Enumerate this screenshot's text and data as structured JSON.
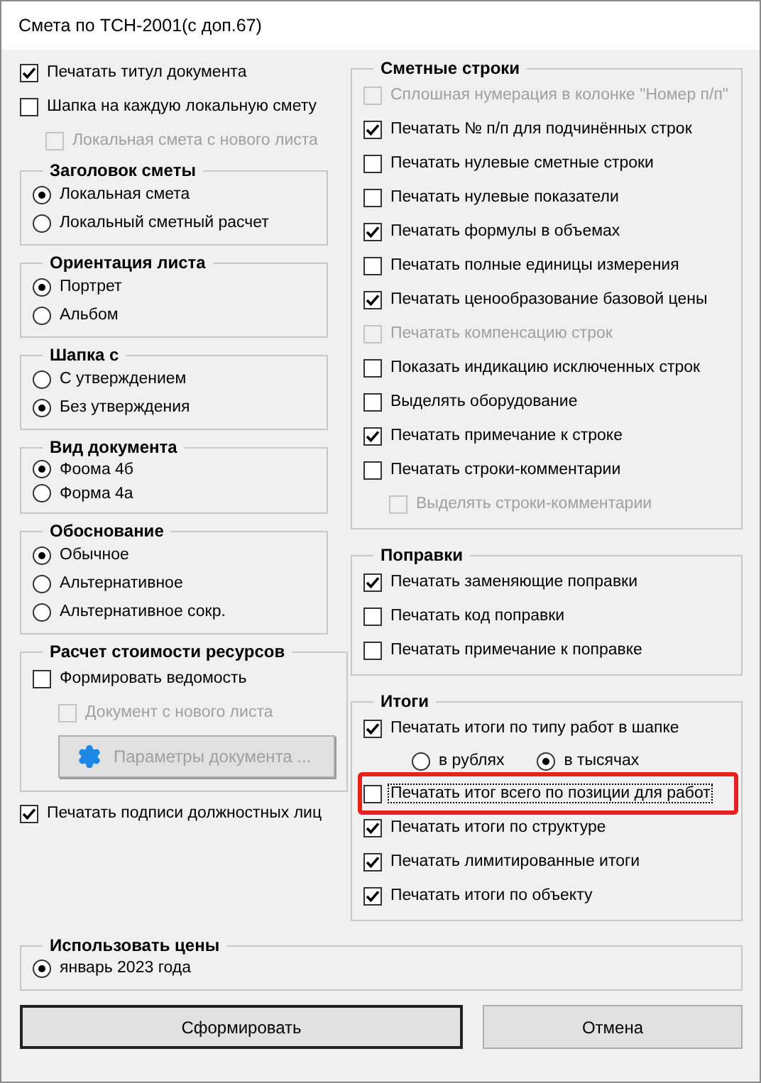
{
  "window": {
    "title": "Смета по ТСН-2001(с доп.67)"
  },
  "left": [
    {
      "kind": "checkbox",
      "label": "Печатать титул документа",
      "checked": true,
      "disabled": false
    },
    {
      "kind": "checkbox",
      "label": "Шапка на каждую локальную смету",
      "checked": false,
      "disabled": false,
      "children": [
        {
          "kind": "checkbox",
          "label": "Локальная смета с нового листа",
          "checked": false,
          "disabled": true
        }
      ]
    },
    {
      "kind": "group",
      "title": "Заголовок сметы",
      "items": [
        {
          "kind": "radio",
          "label": "Локальная смета",
          "selected": true
        },
        {
          "kind": "radio",
          "label": "Локальный сметный расчет",
          "selected": false
        }
      ]
    },
    {
      "kind": "group",
      "title": "Ориентация листа",
      "items": [
        {
          "kind": "radio",
          "label": "Портрет",
          "selected": true
        },
        {
          "kind": "radio",
          "label": "Альбом",
          "selected": false
        }
      ]
    },
    {
      "kind": "group",
      "title": "Шапка с",
      "items": [
        {
          "kind": "radio",
          "label": "С утверждением",
          "selected": false
        },
        {
          "kind": "radio",
          "label": "Без утверждения",
          "selected": true
        }
      ]
    },
    {
      "kind": "group",
      "title": "Вид документа",
      "items": [
        {
          "kind": "radio",
          "label": "Фоома 4б",
          "selected": true
        },
        {
          "kind": "radio",
          "label": "Форма 4а",
          "selected": false
        }
      ]
    },
    {
      "kind": "group",
      "title": "Обоснование",
      "items": [
        {
          "kind": "radio",
          "label": "Обычное",
          "selected": true
        },
        {
          "kind": "radio",
          "label": "Альтернативное",
          "selected": false
        },
        {
          "kind": "radio",
          "label": "Альтернативное сокр.",
          "selected": false
        }
      ]
    },
    {
      "kind": "group",
      "title": "Расчет стоимости ресурсов",
      "items": [
        {
          "kind": "checkbox",
          "label": "Формировать ведомость",
          "checked": false,
          "disabled": false,
          "children": [
            {
              "kind": "checkbox",
              "label": "Документ с нового листа",
              "checked": false,
              "disabled": true
            }
          ]
        },
        {
          "kind": "button",
          "label": "Параметры документа ...",
          "disabled": true
        }
      ]
    },
    {
      "kind": "checkbox",
      "label": "Печатать подписи должностных лиц",
      "checked": true,
      "disabled": false
    }
  ],
  "right": [
    {
      "kind": "group",
      "title": "Сметные строки",
      "items": [
        {
          "kind": "checkbox",
          "label": "Сплошная нумерация в колонке \"Номер п/п\"",
          "checked": false,
          "disabled": true
        },
        {
          "kind": "checkbox",
          "label": "Печатать № п/п для подчинённых строк",
          "checked": true,
          "disabled": false
        },
        {
          "kind": "checkbox",
          "label": "Печатать нулевые сметные строки",
          "checked": false,
          "disabled": false
        },
        {
          "kind": "checkbox",
          "label": "Печатать нулевые показатели",
          "checked": false,
          "disabled": false
        },
        {
          "kind": "checkbox",
          "label": "Печатать формулы в объемах",
          "checked": true,
          "disabled": false
        },
        {
          "kind": "checkbox",
          "label": "Печатать полные единицы измерения",
          "checked": false,
          "disabled": false
        },
        {
          "kind": "checkbox",
          "label": "Печатать ценообразование базовой цены",
          "checked": true,
          "disabled": false
        },
        {
          "kind": "checkbox",
          "label": "Печатать компенсацию строк",
          "checked": false,
          "disabled": true
        },
        {
          "kind": "checkbox",
          "label": "Показать индикацию исключенных строк",
          "checked": false,
          "disabled": false
        },
        {
          "kind": "checkbox",
          "label": "Выделять оборудование",
          "checked": false,
          "disabled": false
        },
        {
          "kind": "checkbox",
          "label": "Печатать примечание к строке",
          "checked": true,
          "disabled": false
        },
        {
          "kind": "checkbox",
          "label": "Печатать строки-комментарии",
          "checked": false,
          "disabled": false,
          "children": [
            {
              "kind": "checkbox",
              "label": "Выделять строки-комментарии",
              "checked": false,
              "disabled": true
            }
          ]
        }
      ]
    },
    {
      "kind": "group",
      "title": "Поправки",
      "items": [
        {
          "kind": "checkbox",
          "label": "Печатать заменяющие поправки",
          "checked": true,
          "disabled": false
        },
        {
          "kind": "checkbox",
          "label": "Печатать код поправки",
          "checked": false,
          "disabled": false
        },
        {
          "kind": "checkbox",
          "label": "Печатать примечание к поправке",
          "checked": false,
          "disabled": false
        }
      ]
    },
    {
      "kind": "group",
      "title": "Итоги",
      "items": [
        {
          "kind": "checkbox",
          "label": "Печатать итоги по типу работ в шапке",
          "checked": true,
          "disabled": false
        },
        {
          "kind": "radio_row",
          "options": [
            {
              "label": "в рублях",
              "selected": false
            },
            {
              "label": "в тысячах",
              "selected": true
            }
          ]
        },
        {
          "kind": "checkbox",
          "label": "Печатать итог всего по позиции для работ",
          "checked": false,
          "disabled": false,
          "focused": true,
          "highlighted": true
        },
        {
          "kind": "checkbox",
          "label": "Печатать итоги по структуре",
          "checked": true,
          "disabled": false
        },
        {
          "kind": "checkbox",
          "label": "Печатать лимитированные итоги",
          "checked": true,
          "disabled": false
        },
        {
          "kind": "checkbox",
          "label": "Печатать итоги по объекту",
          "checked": true,
          "disabled": false
        }
      ]
    }
  ],
  "prices": {
    "title": "Использовать цены",
    "options": [
      {
        "label": "январь 2023 года",
        "selected": true
      }
    ]
  },
  "buttons": [
    {
      "label": "Сформировать",
      "default": true
    },
    {
      "label": "Отмена",
      "default": false
    }
  ]
}
